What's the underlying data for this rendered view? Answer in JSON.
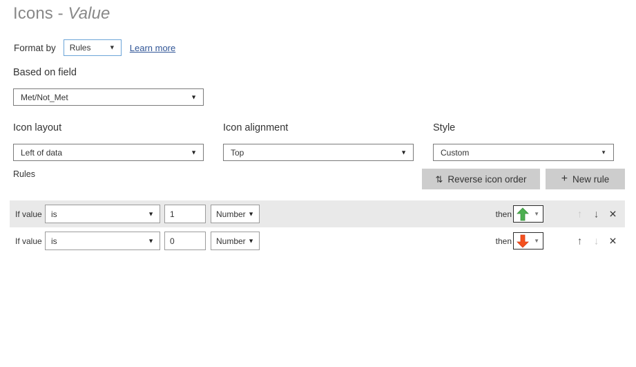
{
  "header": {
    "title_prefix": "Icons - ",
    "title_value": "Value"
  },
  "format_by": {
    "label": "Format by",
    "value": "Rules",
    "caret": "▼",
    "learn_more": "Learn more"
  },
  "based_on_field": {
    "label": "Based on field",
    "value": "Met/Not_Met",
    "caret": "▼"
  },
  "icon_layout": {
    "label": "Icon layout",
    "value": "Left of data",
    "caret": "▼"
  },
  "icon_alignment": {
    "label": "Icon alignment",
    "value": "Top",
    "caret": "▼"
  },
  "style": {
    "label": "Style",
    "value": "Custom",
    "caret": "▼"
  },
  "rules": {
    "label": "Rules",
    "reverse_button": {
      "glyph": "⇅",
      "label": "Reverse icon order"
    },
    "new_rule_button": {
      "glyph": "+",
      "label": "New rule"
    },
    "rows": [
      {
        "if_value_label": "If value",
        "operator": "is",
        "operator_caret": "▼",
        "value": "1",
        "unit": "Number",
        "unit_caret": "▼",
        "then_label": "then",
        "icon": "arrow-up-green",
        "icon_color": "#4caf50",
        "icon_caret": "▼",
        "shaded": true,
        "move_up_enabled": false,
        "move_down_enabled": true,
        "move_up_glyph": "↑",
        "move_down_glyph": "↓",
        "remove_glyph": "✕"
      },
      {
        "if_value_label": "If value",
        "operator": "is",
        "operator_caret": "▼",
        "value": "0",
        "unit": "Number",
        "unit_caret": "▼",
        "then_label": "then",
        "icon": "arrow-down-red",
        "icon_color": "#f4511e",
        "icon_caret": "▼",
        "shaded": false,
        "move_up_enabled": true,
        "move_down_enabled": false,
        "move_up_glyph": "↑",
        "move_down_glyph": "↓",
        "remove_glyph": "✕"
      }
    ]
  },
  "colors": {
    "title": "#888888",
    "link": "#2f5496",
    "focus_border": "#6ba4d8",
    "button_bg": "#cdcdcd",
    "row_shade": "#e9e9e9",
    "green": "#4caf50",
    "red": "#f4511e"
  }
}
